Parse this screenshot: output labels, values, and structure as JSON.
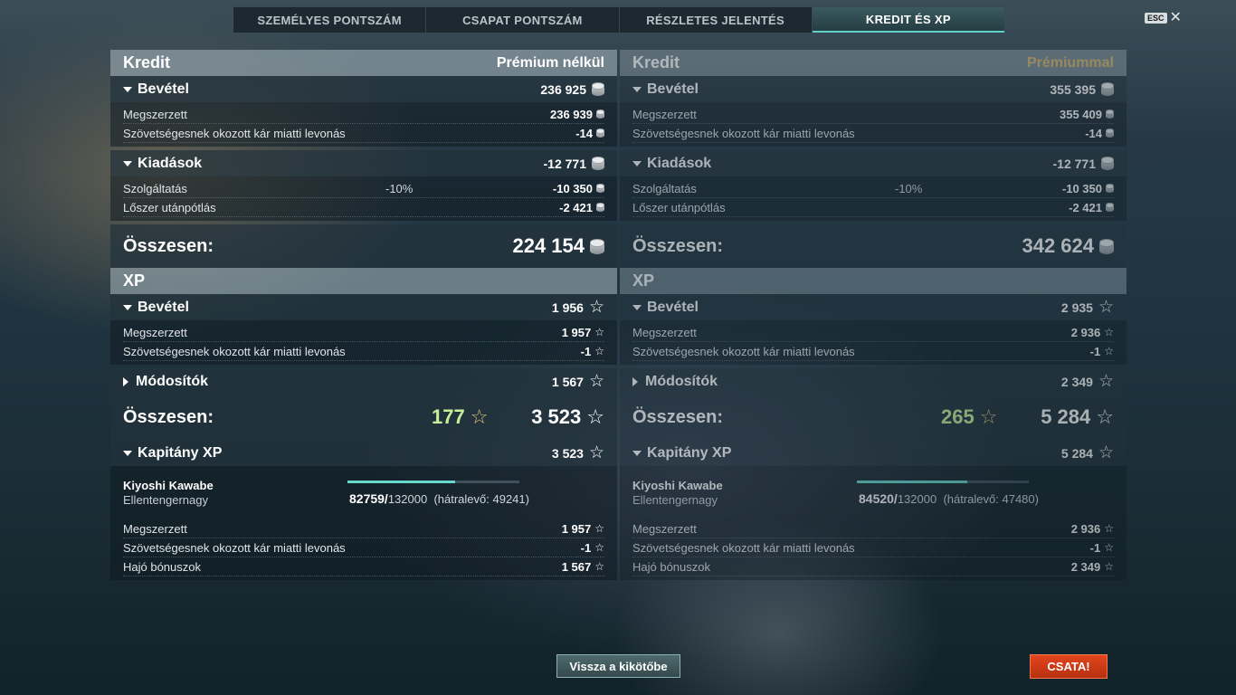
{
  "tabs": [
    {
      "label": "SZEMÉLYES PONTSZÁM",
      "active": false
    },
    {
      "label": "CSAPAT PONTSZÁM",
      "active": false
    },
    {
      "label": "RÉSZLETES JELENTÉS",
      "active": false
    },
    {
      "label": "KREDIT ÉS XP",
      "active": true
    }
  ],
  "esc_label": "ESC",
  "colors": {
    "accent": "#5fd1c7",
    "premium": "#d8b36a",
    "bonus_xp": "#c8f09a",
    "battle_button": "#d23c16"
  },
  "icons": {
    "credit": "credit-coin-icon",
    "xp": "xp-star-icon"
  },
  "left": {
    "credit_title": "Kredit",
    "account_label": "Prémium nélkül",
    "credit_income": {
      "label": "Bevétel",
      "value": "236 925",
      "items": [
        {
          "label": "Megszerzett",
          "value": "236 939"
        },
        {
          "label": "Szövetségesnek okozott kár miatti levonás",
          "value": "-14"
        }
      ]
    },
    "credit_expenses": {
      "label": "Kiadások",
      "value": "-12 771",
      "items": [
        {
          "label": "Szolgáltatás",
          "modifier": "-10%",
          "value": "-10 350"
        },
        {
          "label": "Lőszer utánpótlás",
          "value": "-2 421"
        }
      ]
    },
    "credit_total": {
      "label": "Összesen:",
      "value": "224 154"
    },
    "xp_title": "XP",
    "xp_income": {
      "label": "Bevétel",
      "value": "1 956",
      "items": [
        {
          "label": "Megszerzett",
          "value": "1 957"
        },
        {
          "label": "Szövetségesnek okozott kár miatti levonás",
          "value": "-1"
        }
      ]
    },
    "modifiers": {
      "label": "Módosítók",
      "value": "1 567"
    },
    "xp_total": {
      "label": "Összesen:",
      "bonus": "177",
      "value": "3 523"
    },
    "captain": {
      "label": "Kapitány XP",
      "value": "3 523",
      "name": "Kiyoshi Kawabe",
      "rank": "Ellentengernagy",
      "progress_current": "82759/",
      "progress_max": "132000",
      "remaining": "(hátralevő: 49241)",
      "progress_fraction": 0.627,
      "items": [
        {
          "label": "Megszerzett",
          "value": "1 957"
        },
        {
          "label": "Szövetségesnek okozott kár miatti levonás",
          "value": "-1"
        },
        {
          "label": "Hajó bónuszok",
          "value": "1 567"
        }
      ]
    }
  },
  "right": {
    "credit_title": "Kredit",
    "account_label": "Prémiummal",
    "credit_income": {
      "label": "Bevétel",
      "value": "355 395",
      "items": [
        {
          "label": "Megszerzett",
          "value": "355 409"
        },
        {
          "label": "Szövetségesnek okozott kár miatti levonás",
          "value": "-14"
        }
      ]
    },
    "credit_expenses": {
      "label": "Kiadások",
      "value": "-12 771",
      "items": [
        {
          "label": "Szolgáltatás",
          "modifier": "-10%",
          "value": "-10 350"
        },
        {
          "label": "Lőszer utánpótlás",
          "value": "-2 421"
        }
      ]
    },
    "credit_total": {
      "label": "Összesen:",
      "value": "342 624"
    },
    "xp_title": "XP",
    "xp_income": {
      "label": "Bevétel",
      "value": "2 935",
      "items": [
        {
          "label": "Megszerzett",
          "value": "2 936"
        },
        {
          "label": "Szövetségesnek okozott kár miatti levonás",
          "value": "-1"
        }
      ]
    },
    "modifiers": {
      "label": "Módosítók",
      "value": "2 349"
    },
    "xp_total": {
      "label": "Összesen:",
      "bonus": "265",
      "value": "5 284"
    },
    "captain": {
      "label": "Kapitány XP",
      "value": "5 284",
      "name": "Kiyoshi Kawabe",
      "rank": "Ellentengernagy",
      "progress_current": "84520/",
      "progress_max": "132000",
      "remaining": "(hátralevő: 47480)",
      "progress_fraction": 0.64,
      "items": [
        {
          "label": "Megszerzett",
          "value": "2 936"
        },
        {
          "label": "Szövetségesnek okozott kár miatti levonás",
          "value": "-1"
        },
        {
          "label": "Hajó bónuszok",
          "value": "2 349"
        }
      ]
    }
  },
  "buttons": {
    "back_to_port": "Vissza a kikötőbe",
    "battle": "CSATA!"
  }
}
